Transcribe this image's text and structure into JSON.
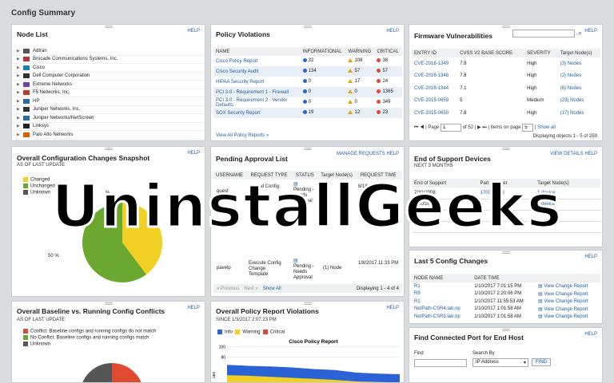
{
  "page_title": "Config Summary",
  "help": "HELP",
  "node_list": {
    "title": "Node List",
    "nodes": [
      "Adtran",
      "Brocade Communications Systems, Inc.",
      "Cisco",
      "Dell Computer Corporation",
      "Extreme Networks",
      "F5 Networks, Inc.",
      "HP",
      "Juniper Networks, Inc.",
      "Juniper Networks/NetScreen",
      "Linksys",
      "Palo Alto Networks"
    ]
  },
  "policy_violations": {
    "title": "Policy Violations",
    "headers": [
      "NAME",
      "INFORMATIONAL",
      "WARNING",
      "CRITICAL"
    ],
    "rows": [
      {
        "name": "Cisco Policy Report",
        "info": "32",
        "warn": "108",
        "crit": "38"
      },
      {
        "name": "Cisco Security Audit",
        "info": "134",
        "warn": "57",
        "crit": "57"
      },
      {
        "name": "HIPAA Security Report",
        "info": "0",
        "warn": "17",
        "crit": "24"
      },
      {
        "name": "PCI 3-0 - Requirement 1 - Firewall",
        "info": "0",
        "warn": "0",
        "crit": "1365"
      },
      {
        "name": "PCI 3-0 - Requirement 2 - Vendor Defaults",
        "info": "0",
        "warn": "0",
        "crit": "349"
      },
      {
        "name": "SOX Security Report",
        "info": "19",
        "warn": "12",
        "crit": "23"
      }
    ],
    "view_all": "View All Policy Reports »"
  },
  "firmware": {
    "title": "Firmware Vulnerabilities",
    "headers": [
      "ENTRY ID",
      "CVSS V2 BASE SCORE",
      "SEVERITY",
      "Target Node(s)"
    ],
    "rows": [
      {
        "id": "CVE-2016-1349",
        "score": "7.8",
        "sev": "High",
        "nodes": "(3) Nodes"
      },
      {
        "id": "CVE-2016-1348",
        "score": "7.8",
        "sev": "High",
        "nodes": "(2) Nodes"
      },
      {
        "id": "CVE-2016-1344",
        "score": "7.1",
        "sev": "High",
        "nodes": "(6) Nodes"
      },
      {
        "id": "CVE-2015-0659",
        "score": "5",
        "sev": "Medium",
        "nodes": "(23) Nodes"
      },
      {
        "id": "CVE-2015-0650",
        "score": "7.8",
        "sev": "High",
        "nodes": "(17) Nodes"
      }
    ],
    "pager_page_label": "Page",
    "pager_page": "1",
    "pager_of": "of 52",
    "items_label": "Items on page",
    "items_value": "5",
    "show_all": "Show all",
    "displaying": "Displaying objects 1 - 5 of 259"
  },
  "config_changes": {
    "title": "Overall Configuration Changes Snapshot",
    "subtitle": "AS OF LAST UPDATE",
    "legend": [
      "Changed",
      "Unchanged",
      "Unknown"
    ],
    "label_50": "50 %",
    "label_pct": "%"
  },
  "pending": {
    "title": "Pending Approval List",
    "manage": "MANAGE REQUESTS",
    "headers": [
      "USERNAME",
      "REQUEST TYPE",
      "STATUS",
      "Target Node(s)",
      "REQUEST TIME"
    ],
    "rows": [
      {
        "user": "guest",
        "type": "Upload Config",
        "status": "Pending - Needs Approval",
        "nodes": "",
        "time": "8/18/2017 11:45"
      },
      {
        "user": "pavelp",
        "type": "Execute Config Change Template",
        "status": "Pending - Needs Approval",
        "nodes": "(1) Node",
        "time": "1/8/2017 11:33 PM"
      }
    ],
    "prev": "« Previous",
    "next": "Next »",
    "show_all": "Show All",
    "displaying": "Displaying 1 - 4 of 4"
  },
  "eos": {
    "title": "End of Support Devices",
    "view_details": "VIEW DETAILS",
    "subtitle": "NEXT 3 MONTHS",
    "headers": [
      "End of Support",
      "Part Number",
      "Target Node(s)"
    ],
    "rows": [
      {
        "date": "7/31/2008",
        "part": "1700615E2",
        "nodes": "1 device"
      },
      {
        "date": "9/20/2008",
        "part": "",
        "nodes": "1 device"
      },
      {
        "date": "",
        "part": "",
        "nodes": ""
      },
      {
        "date": "",
        "part": "",
        "nodes": ""
      }
    ]
  },
  "last_changes": {
    "title": "Last 5 Config Changes",
    "headers": [
      "NODE NAME",
      "DATE TIME",
      ""
    ],
    "rows": [
      {
        "node": "R1",
        "time": "1/10/2017 7:01:15 PM",
        "action": "View Change Report"
      },
      {
        "node": "R9",
        "time": "1/10/2017 2:20:06 PM",
        "action": "View Change Report"
      },
      {
        "node": "R1",
        "time": "1/10/2017 11:55:53 AM",
        "action": "View Change Report"
      },
      {
        "node": "NetPath-CSR4.lab.np",
        "time": "1/10/2017 1:01:58 AM",
        "action": "View Change Report"
      },
      {
        "node": "NetPath-CSR3.lab.np",
        "time": "1/10/2017 1:01:58 AM",
        "action": "View Change Report"
      }
    ]
  },
  "baseline": {
    "title": "Overall Baseline vs. Running Config Conflicts",
    "subtitle": "AS OF LAST UPDATE",
    "legend": [
      "Conflict: Baseline configs and running configs do not match",
      "No Conflict: Baseline configs and running configs match",
      "Unknown"
    ]
  },
  "policy_report": {
    "title": "Overall Policy Report Violations",
    "subtitle": "SINCE 1/3/2017 2:07:23 PM",
    "legend": [
      "Info",
      "Warning",
      "Critical"
    ],
    "ylabel": "ues"
  },
  "chart_data": {
    "type": "area",
    "title": "Cisco Policy Report",
    "yticks": [
      100,
      80
    ],
    "series": [
      {
        "name": "Info",
        "values": [
          65,
          63,
          62,
          60,
          57,
          55,
          50,
          48,
          47
        ]
      },
      {
        "name": "Warning",
        "values": [
          45,
          44,
          42,
          40,
          38,
          36,
          33,
          32,
          31
        ]
      },
      {
        "name": "Critical",
        "values": [
          0,
          0,
          0,
          0,
          0,
          0,
          0,
          0,
          0
        ]
      }
    ]
  },
  "find_port": {
    "title": "Find Connected Port for End Host",
    "find_label": "Find",
    "search_by_label": "Search By",
    "search_by_value": "IP Address",
    "find_button": "FIND"
  },
  "watermark": "UninstallGeeks",
  "colors": {
    "link": "#1f5fa8",
    "changed": "#f2d024",
    "unchanged": "#6aa82f",
    "unknown": "#555555",
    "conflict": "#e04a2e",
    "info": "#2b63d6",
    "warning": "#f2d024",
    "critical": "#e04a2e"
  }
}
